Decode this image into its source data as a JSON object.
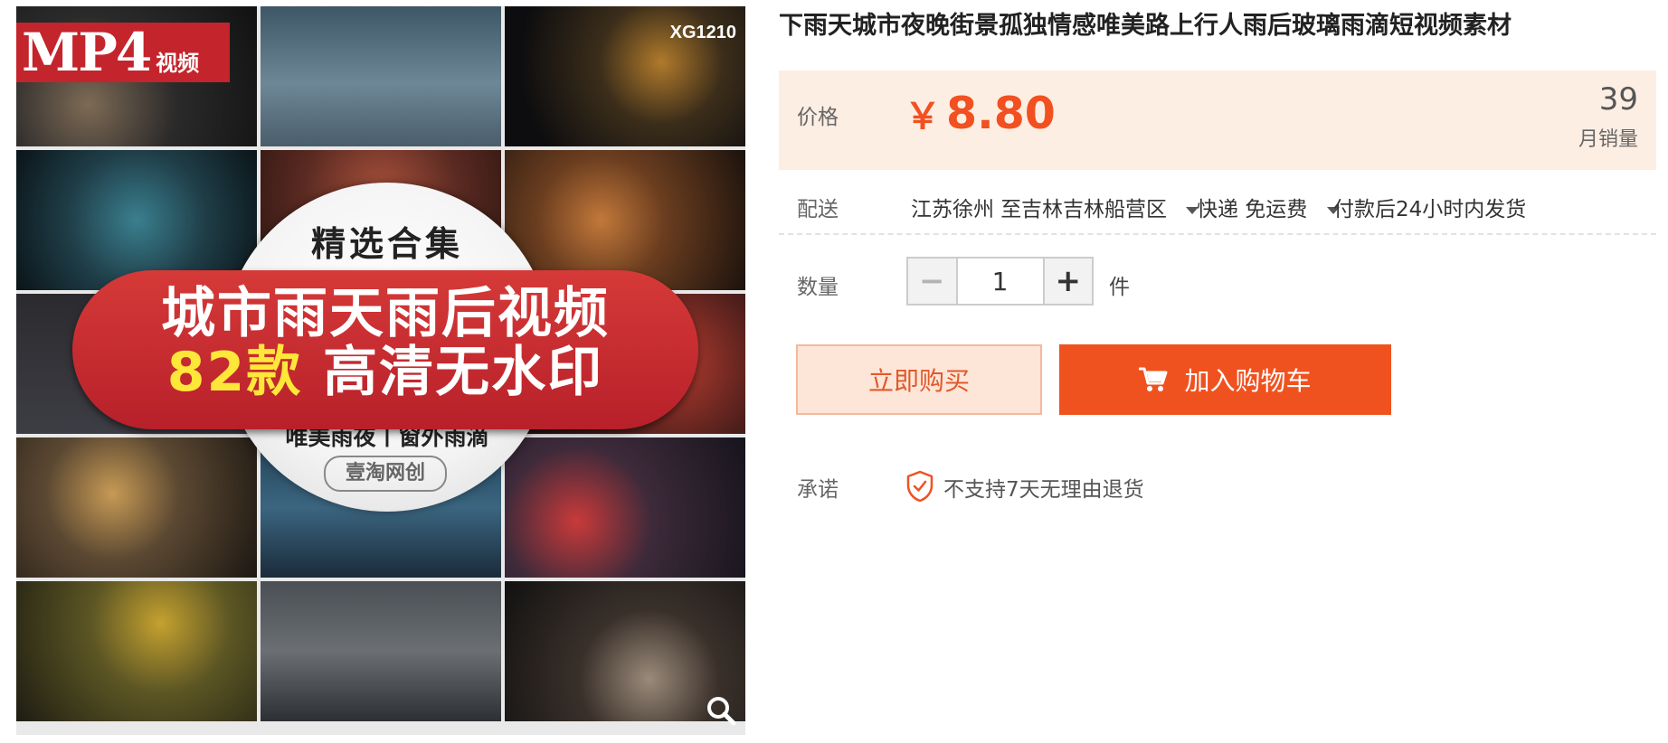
{
  "product": {
    "title": "下雨天城市夜晚街景孤独情感唯美路上行人雨后玻璃雨滴短视频素材"
  },
  "image": {
    "badge_format": "MP4",
    "badge_type": "视频",
    "code": "XG1210",
    "circle_title": "精选合集",
    "banner_line1": "城市雨天雨后视频",
    "banner_count": "82款",
    "banner_line2_rest": " 高清无水印",
    "circle_subtitle": "唯美雨夜丨窗外雨滴",
    "brand": "壹淘网创"
  },
  "price": {
    "label": "价格",
    "currency": "￥",
    "value": "8.80",
    "monthly_sales": "39",
    "monthly_sales_label": "月销量"
  },
  "delivery": {
    "label": "配送",
    "from": "江苏徐州 至",
    "to": "吉林吉林船营区",
    "method": "快递 免运费",
    "ship_time": "付款后24小时内发货"
  },
  "quantity": {
    "label": "数量",
    "value": "1",
    "unit": "件",
    "minus": "−",
    "plus": "+"
  },
  "actions": {
    "buy_now": "立即购买",
    "add_to_cart": "加入购物车"
  },
  "promise": {
    "label": "承诺",
    "text": "不支持7天无理由退货"
  },
  "colors": {
    "accent": "#f0521f",
    "price": "#f25020",
    "price_bg": "#fdeee3",
    "buy_now_bg": "#fde5d8"
  },
  "icons": [
    "zoom-icon",
    "cart-icon",
    "shield-icon",
    "chevron-down-icon"
  ]
}
